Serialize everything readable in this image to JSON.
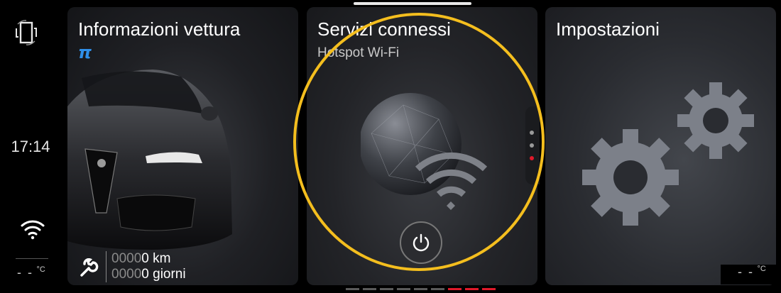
{
  "sidebar": {
    "rotate_icon": "rotate-screen-icon",
    "time": "17:14",
    "wifi_icon": "wifi-icon",
    "temp": {
      "value": "- -",
      "unit": "°C"
    }
  },
  "panels": {
    "vehicle_info": {
      "title": "Informazioni vettura",
      "brand_mark": "π",
      "odometer": {
        "km_prefix": "0000",
        "km_value": "0 km",
        "days_prefix": "0000",
        "days_value": "0 giorni"
      },
      "wrench_icon": "wrench-icon"
    },
    "connected_services": {
      "title": "Servizi connessi",
      "subtitle": "Hotspot Wi-Fi",
      "power_icon": "power-icon"
    },
    "settings": {
      "title": "Impostazioni",
      "temp": {
        "value": "- -",
        "unit": "°C"
      }
    }
  },
  "colors": {
    "accent_red": "#e0192a",
    "highlight": "#f4be1e",
    "brand_blue": "#2f8fe8"
  },
  "pager": {
    "total": 9,
    "active_from": 6
  }
}
